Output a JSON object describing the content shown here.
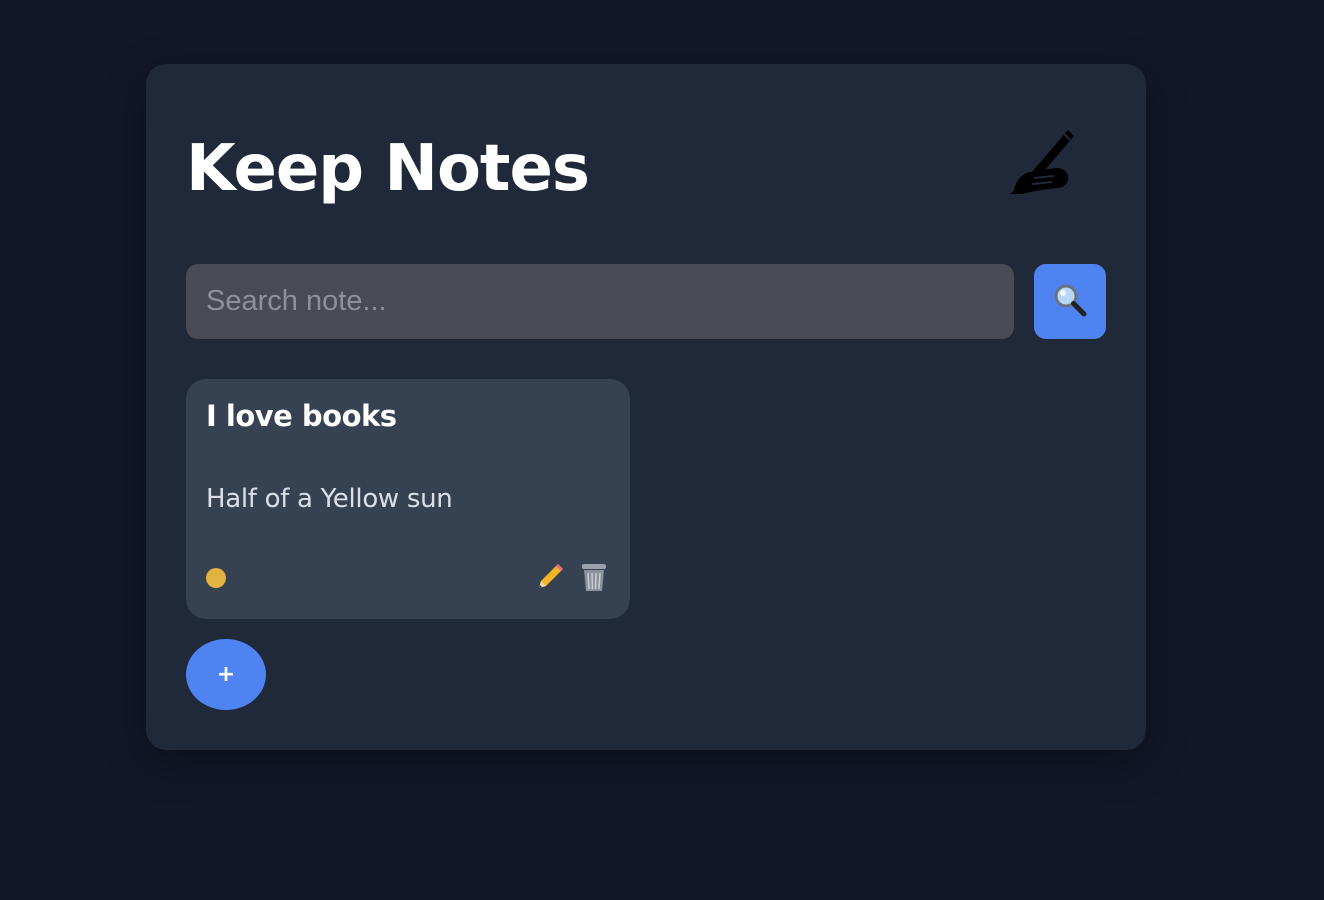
{
  "app": {
    "title": "Keep Notes",
    "header_icon": "writing-hand-icon"
  },
  "search": {
    "placeholder": "Search note...",
    "value": "",
    "button_icon": "magnifier-icon"
  },
  "notes": [
    {
      "title": "I love books",
      "body": "Half of a Yellow sun",
      "color": "#e3b341",
      "actions": [
        "pencil-icon",
        "trash-icon"
      ]
    }
  ],
  "add_button": {
    "label": "+"
  },
  "colors": {
    "background": "#121829",
    "panel": "#1f293a",
    "card": "#364152",
    "accent": "#4f83f2",
    "search_field": "#484b53"
  }
}
